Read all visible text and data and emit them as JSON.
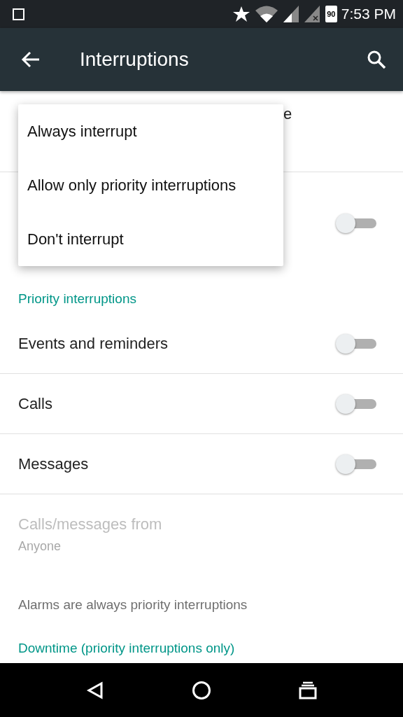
{
  "status_bar": {
    "battery_level_text": "90",
    "time": "7:53 PM"
  },
  "app_bar": {
    "title": "Interruptions"
  },
  "rows_behind_menu": [
    {
      "visible_text": "e"
    },
    {
      "toggle": {
        "on": false
      }
    }
  ],
  "section_header": "Priority interruptions",
  "toggle_rows": [
    {
      "label": "Events and reminders",
      "on": false
    },
    {
      "label": "Calls",
      "on": false
    },
    {
      "label": "Messages",
      "on": false
    }
  ],
  "calls_from": {
    "title": "Calls/messages from",
    "value": "Anyone",
    "disabled": true
  },
  "note": "Alarms are always priority interruptions",
  "next_section_header": "Downtime (priority interruptions only)",
  "menu": {
    "items": [
      {
        "label": "Always interrupt"
      },
      {
        "label": "Allow only priority interruptions"
      },
      {
        "label": "Don't interrupt"
      }
    ]
  }
}
